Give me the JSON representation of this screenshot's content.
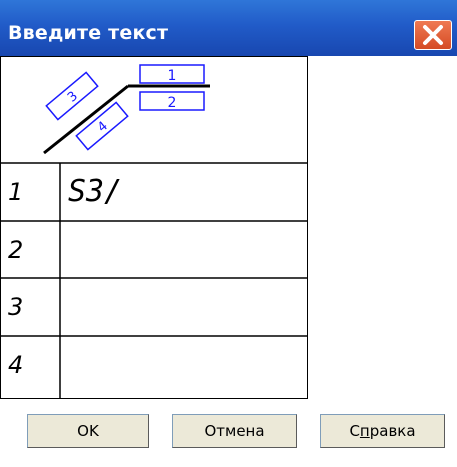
{
  "window": {
    "title": "Введите текст"
  },
  "diagram": {
    "labels": [
      "1",
      "2",
      "3",
      "4"
    ]
  },
  "rows": [
    {
      "num": "1",
      "text": "S3/"
    },
    {
      "num": "2",
      "text": ""
    },
    {
      "num": "3",
      "text": ""
    },
    {
      "num": "4",
      "text": ""
    }
  ],
  "buttons": {
    "ok": "OK",
    "cancel": "Отмена",
    "help_prefix": "С",
    "help_underlined": "п",
    "help_suffix": "равка"
  },
  "colors": {
    "titlebar": "#215bc8",
    "close": "#d54b24",
    "diagram_blue": "#1a1aff"
  }
}
